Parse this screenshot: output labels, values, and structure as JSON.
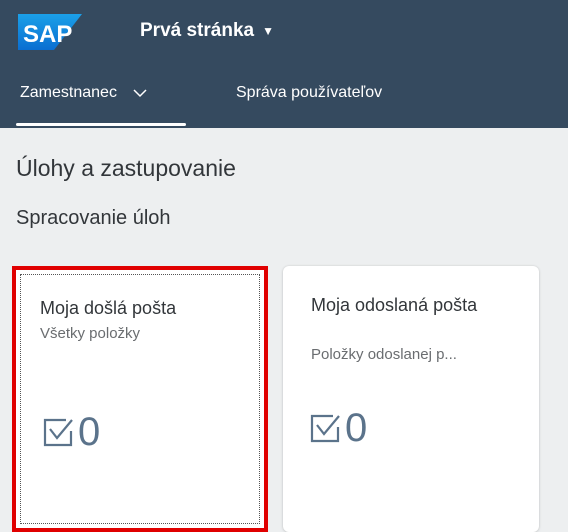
{
  "header": {
    "logo_text": "SAP",
    "page_title": "Prvá stránka",
    "caret": "▼",
    "brand_color": "#0a6ed1",
    "background": "#354a5f"
  },
  "tabs": [
    {
      "label": "Zamestnanec",
      "selected": true,
      "icon": "chevron-down-icon"
    },
    {
      "label": "Správa používateľov",
      "selected": false
    }
  ],
  "section": {
    "title": "Úlohy a zastupovanie"
  },
  "group": {
    "title": "Spracovanie úloh"
  },
  "tiles": [
    {
      "title": "Moja došlá pošta",
      "subtitle": "Všetky položky",
      "icon": "task-check-icon",
      "value": "0",
      "highlighted": true,
      "highlight_color": "#e00000"
    },
    {
      "title": "Moja odoslaná pošta",
      "subtitle": "Položky odoslanej p...",
      "icon": "task-check-icon",
      "value": "0",
      "highlighted": false
    }
  ]
}
